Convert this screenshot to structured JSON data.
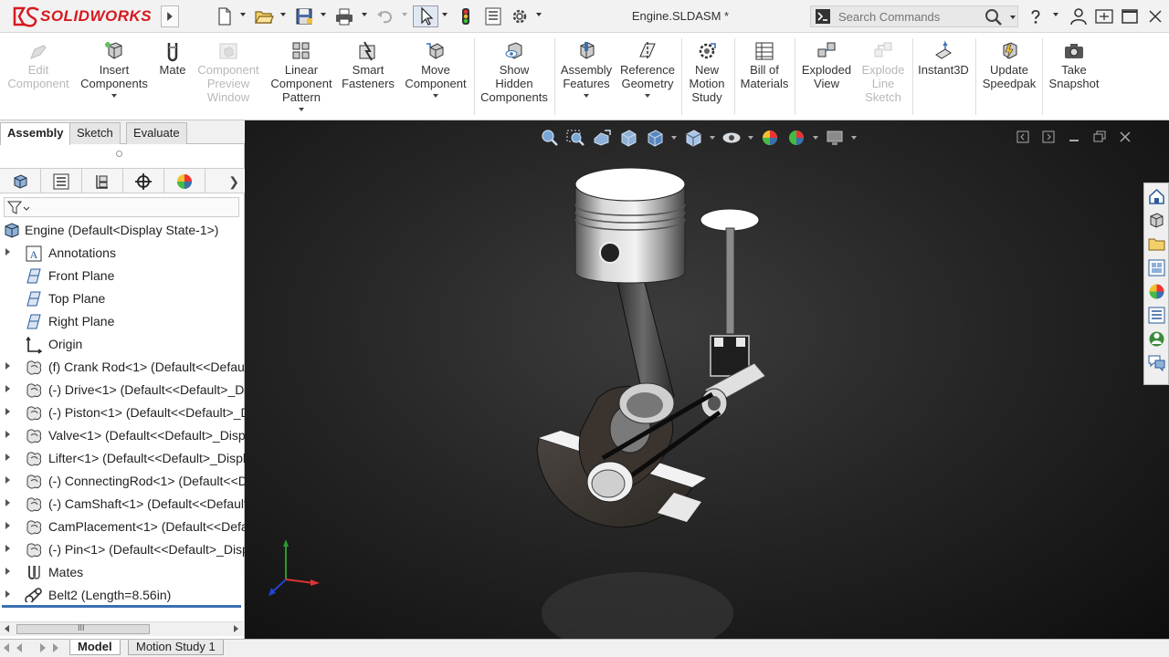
{
  "app": {
    "brand": "SOLIDWORKS",
    "document_title": "Engine.SLDASM *",
    "brand_color": "#d71920"
  },
  "search": {
    "placeholder": "Search Commands"
  },
  "toolbar_icons": [
    "logo-icon",
    "expand-menu-icon",
    "new-document-icon",
    "open-icon",
    "save-icon",
    "print-icon",
    "undo-icon",
    "select-icon",
    "rebuild-icon",
    "file-properties-icon",
    "options-icon",
    "search-commands-icon",
    "search-icon",
    "help-icon",
    "user-icon",
    "minimize-icon",
    "restore-icon",
    "close-icon"
  ],
  "command_manager": {
    "buttons": [
      {
        "label": "Edit\nComponent",
        "icon": "edit-component-icon",
        "enabled": false,
        "dropdown": false
      },
      {
        "label": "Insert\nComponents",
        "icon": "insert-components-icon",
        "enabled": true,
        "dropdown": true
      },
      {
        "label": "Mate",
        "icon": "mate-icon",
        "enabled": true,
        "dropdown": false
      },
      {
        "label": "Component\nPreview\nWindow",
        "icon": "component-preview-icon",
        "enabled": false,
        "dropdown": false
      },
      {
        "label": "Linear\nComponent\nPattern",
        "icon": "linear-pattern-icon",
        "enabled": true,
        "dropdown": true
      },
      {
        "label": "Smart\nFasteners",
        "icon": "smart-fasteners-icon",
        "enabled": true,
        "dropdown": false
      },
      {
        "label": "Move\nComponent",
        "icon": "move-component-icon",
        "enabled": true,
        "dropdown": true
      },
      {
        "label": "Show\nHidden\nComponents",
        "icon": "show-hidden-icon",
        "enabled": true,
        "dropdown": false
      },
      {
        "label": "Assembly\nFeatures",
        "icon": "assembly-features-icon",
        "enabled": true,
        "dropdown": true
      },
      {
        "label": "Reference\nGeometry",
        "icon": "reference-geometry-icon",
        "enabled": true,
        "dropdown": true
      },
      {
        "label": "New\nMotion\nStudy",
        "icon": "motion-study-icon",
        "enabled": true,
        "dropdown": false
      },
      {
        "label": "Bill of\nMaterials",
        "icon": "bom-icon",
        "enabled": true,
        "dropdown": false
      },
      {
        "label": "Exploded\nView",
        "icon": "exploded-view-icon",
        "enabled": true,
        "dropdown": false
      },
      {
        "label": "Explode\nLine\nSketch",
        "icon": "explode-line-icon",
        "enabled": false,
        "dropdown": false
      },
      {
        "label": "Instant3D",
        "icon": "instant3d-icon",
        "enabled": true,
        "dropdown": false
      },
      {
        "label": "Update\nSpeedpak",
        "icon": "speedpak-icon",
        "enabled": true,
        "dropdown": false
      },
      {
        "label": "Take\nSnapshot",
        "icon": "snapshot-icon",
        "enabled": true,
        "dropdown": false
      }
    ]
  },
  "panel_tabs": [
    {
      "label": "Assembly",
      "active": true
    },
    {
      "label": "Sketch",
      "active": false
    },
    {
      "label": "Evaluate",
      "active": false
    }
  ],
  "manager_tabs": [
    "feature-manager-icon",
    "property-manager-icon",
    "configuration-manager-icon",
    "dimxpert-icon",
    "display-manager-icon"
  ],
  "tree": {
    "root": "Engine  (Default<Display State-1>)",
    "items": [
      {
        "label": "Annotations",
        "icon": "annotations-icon",
        "expandable": true
      },
      {
        "label": "Front Plane",
        "icon": "plane-icon",
        "expandable": false
      },
      {
        "label": "Top Plane",
        "icon": "plane-icon",
        "expandable": false
      },
      {
        "label": "Right Plane",
        "icon": "plane-icon",
        "expandable": false
      },
      {
        "label": "Origin",
        "icon": "origin-icon",
        "expandable": false
      },
      {
        "label": "(f) Crank Rod<1> (Default<<Defaul",
        "icon": "part-icon",
        "expandable": true
      },
      {
        "label": "(-) Drive<1> (Default<<Default>_Di",
        "icon": "part-icon",
        "expandable": true
      },
      {
        "label": "(-) Piston<1> (Default<<Default>_D",
        "icon": "part-icon",
        "expandable": true
      },
      {
        "label": "Valve<1> (Default<<Default>_Displ",
        "icon": "part-icon",
        "expandable": true
      },
      {
        "label": "Lifter<1> (Default<<Default>_Displ",
        "icon": "part-icon",
        "expandable": true
      },
      {
        "label": "(-) ConnectingRod<1> (Default<<D",
        "icon": "part-icon",
        "expandable": true
      },
      {
        "label": "(-) CamShaft<1> (Default<<Default",
        "icon": "part-icon",
        "expandable": true
      },
      {
        "label": "CamPlacement<1> (Default<<Defa",
        "icon": "part-icon",
        "expandable": true
      },
      {
        "label": "(-) Pin<1> (Default<<Default>_Disp",
        "icon": "part-icon",
        "expandable": true
      },
      {
        "label": "Mates",
        "icon": "mates-icon",
        "expandable": true
      },
      {
        "label": "Belt2 (Length=8.56in)",
        "icon": "belt-icon",
        "expandable": true
      }
    ]
  },
  "hscroll_grip": "III",
  "viewport": {
    "heads_up_icons": [
      "zoom-to-fit-icon",
      "zoom-to-area-icon",
      "previous-view-icon",
      "section-view-icon",
      "view-orientation-icon",
      "display-style-icon",
      "hide-show-items-icon",
      "edit-appearance-icon",
      "apply-scene-icon",
      "view-settings-icon"
    ],
    "task_pane_icons": [
      "home-icon",
      "design-library-icon",
      "file-explorer-icon",
      "view-palette-icon",
      "appearances-icon",
      "custom-properties-icon",
      "solidworks-forum-icon",
      "comments-icon"
    ],
    "triad_axes": [
      "x-axis",
      "y-axis",
      "z-axis"
    ]
  },
  "bottom_tabs": [
    {
      "label": "Model",
      "active": true
    },
    {
      "label": "Motion Study 1",
      "active": false
    }
  ]
}
